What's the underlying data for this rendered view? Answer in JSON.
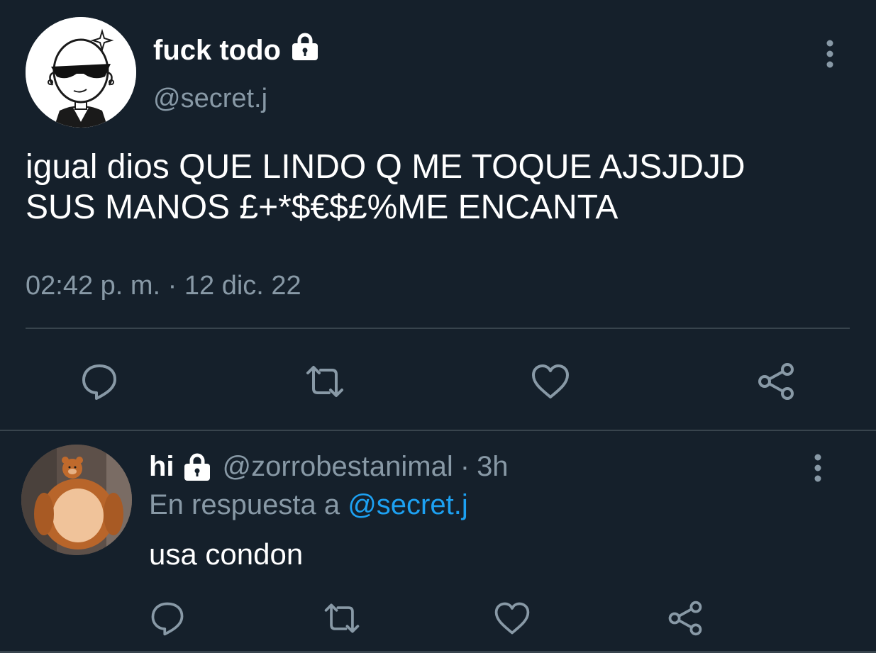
{
  "tweet": {
    "display_name": "fuck todo",
    "protected_icon": "lock-icon",
    "handle": "@secret.j",
    "text": "igual dios QUE LINDO Q ME TOQUE AJSJDJD\nSUS MANOS £+*$€$£%ME ENCANTA",
    "timestamp": "02:42 p. m. · 12 dic. 22",
    "more_icon": "more-vertical-icon",
    "actions": [
      "reply-icon",
      "retweet-icon",
      "like-icon",
      "share-icon"
    ]
  },
  "reply": {
    "display_name": "hi",
    "protected_icon": "lock-icon",
    "handle": "@zorrobestanimal",
    "separator": "·",
    "time": "3h",
    "in_reply_prefix": "En respuesta a",
    "in_reply_mention": "@secret.j",
    "text": "usa condon",
    "more_icon": "more-vertical-icon",
    "actions": [
      "reply-icon",
      "retweet-icon",
      "like-icon",
      "share-icon"
    ]
  },
  "colors": {
    "background": "#15202b",
    "primary_text": "#ffffff",
    "secondary_text": "#8899a6",
    "icon": "#8899a6",
    "link": "#1da1f2",
    "divider": "#38444d"
  }
}
